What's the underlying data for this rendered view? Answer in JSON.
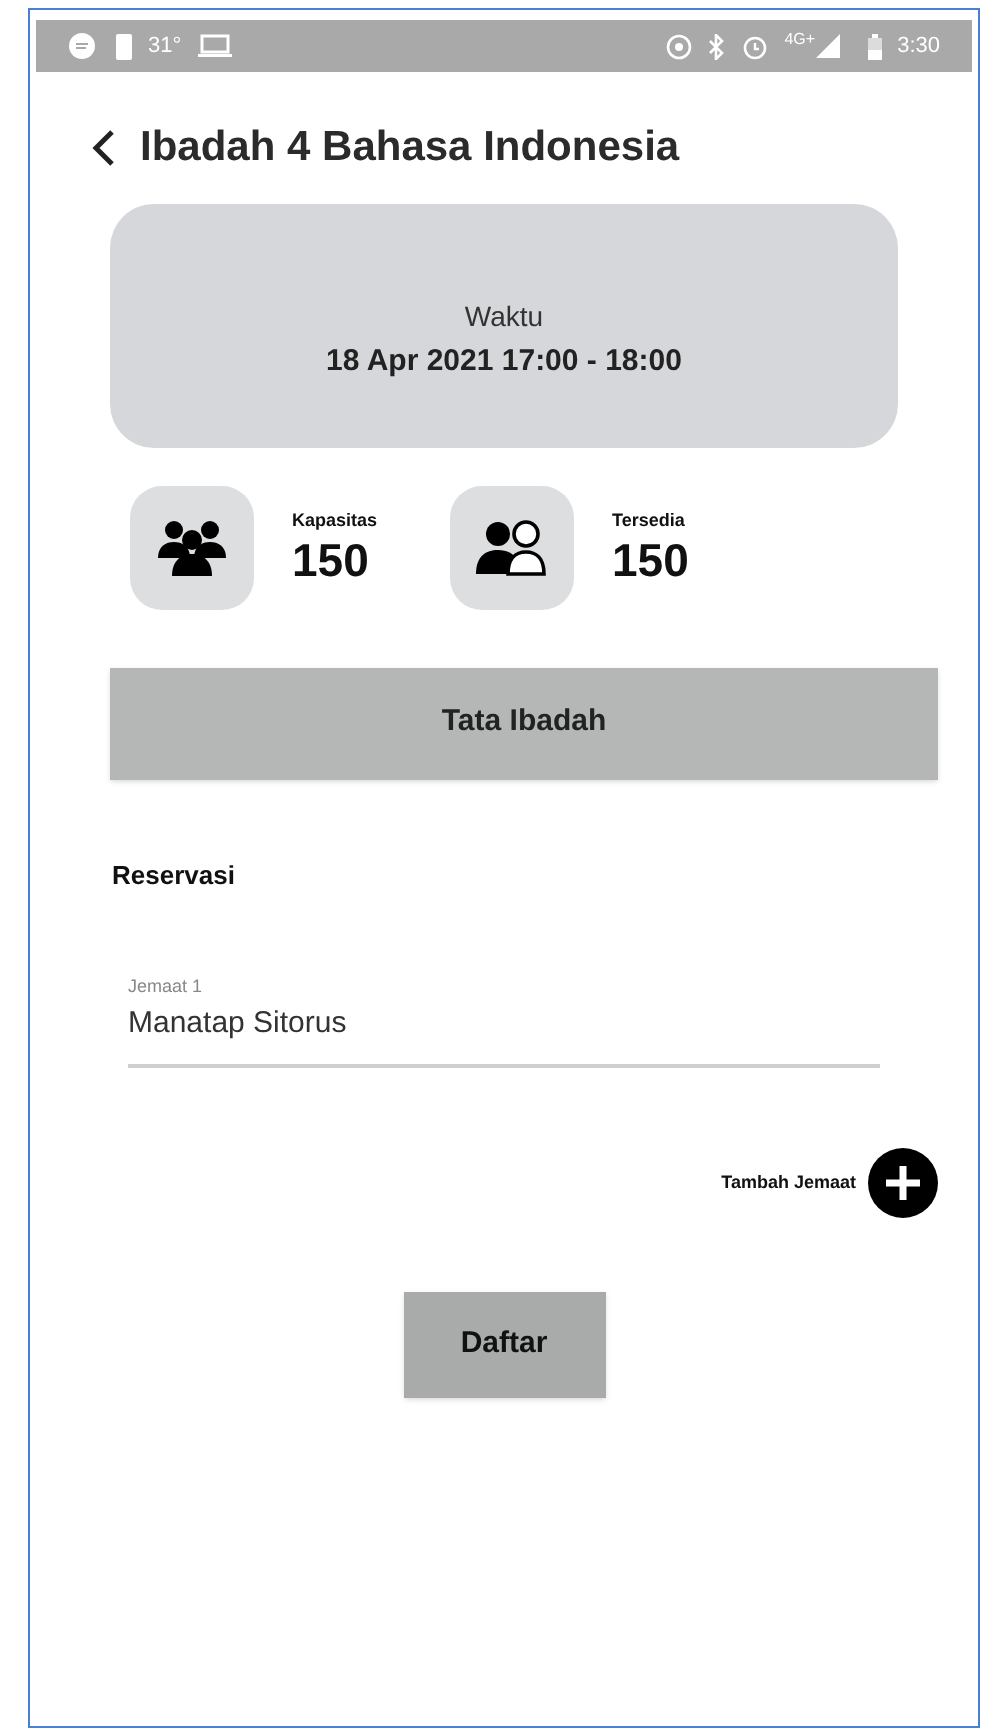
{
  "status_bar": {
    "temperature": "31°",
    "network": "4G+",
    "time": "3:30"
  },
  "header": {
    "title": "Ibadah 4 Bahasa Indonesia"
  },
  "schedule": {
    "label": "Waktu",
    "value": "18 Apr 2021 17:00 - 18:00"
  },
  "stats": [
    {
      "kind": "group",
      "label": "Kapasitas",
      "value": "150"
    },
    {
      "kind": "available",
      "label": "Tersedia",
      "value": "150"
    }
  ],
  "order_button": "Tata Ibadah",
  "reservation": {
    "title": "Reservasi",
    "fields": [
      {
        "label": "Jemaat 1",
        "value": "Manatap Sitorus"
      }
    ],
    "add_label": "Tambah Jemaat",
    "submit": "Daftar"
  }
}
